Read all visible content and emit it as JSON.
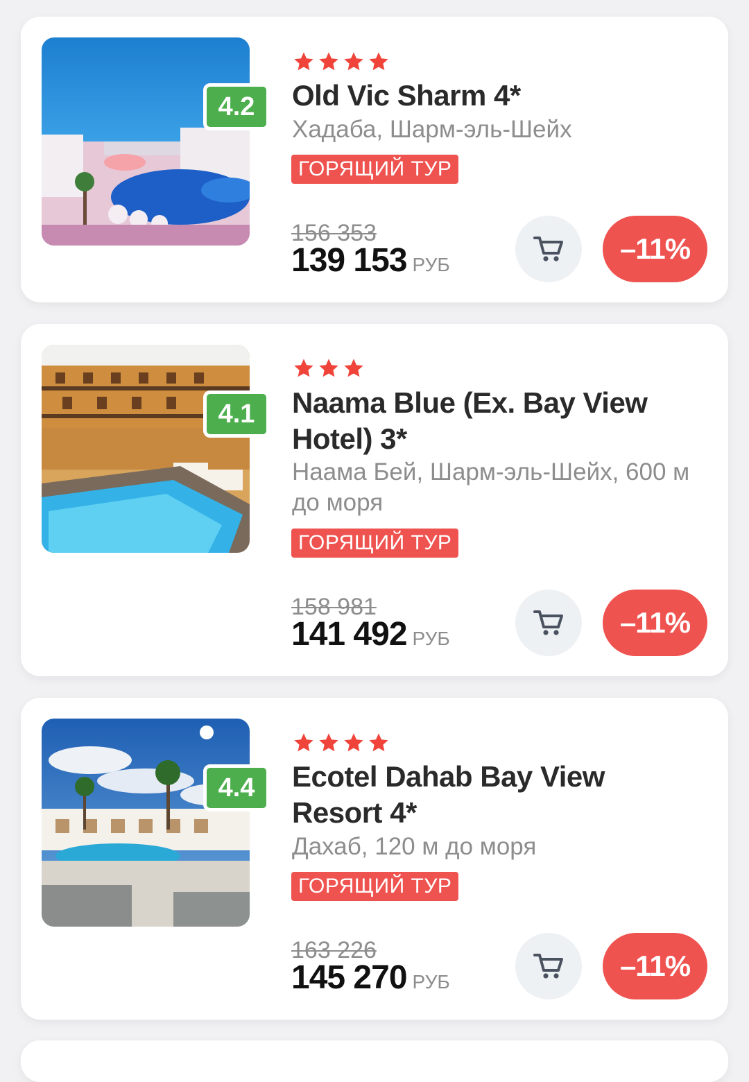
{
  "cards": [
    {
      "rating": "4.2",
      "stars": 4,
      "name": "Old Vic Sharm 4*",
      "location": "Хадаба, Шарм-эль-Шейх",
      "badge": "ГОРЯЩИЙ ТУР",
      "old_price": "156 353",
      "price": "139 153",
      "currency": "РУБ",
      "discount": "–11%"
    },
    {
      "rating": "4.1",
      "stars": 3,
      "name": "Naama Blue (Ex. Bay View Hotel) 3*",
      "location": "Наама Бей, Шарм-эль-Шейх, 600 м до моря",
      "badge": "ГОРЯЩИЙ ТУР",
      "old_price": "158 981",
      "price": "141 492",
      "currency": "РУБ",
      "discount": "–11%"
    },
    {
      "rating": "4.4",
      "stars": 4,
      "name": "Ecotel Dahab Bay View Resort 4*",
      "location": "Дахаб, 120 м до моря",
      "badge": "ГОРЯЩИЙ ТУР",
      "old_price": "163 226",
      "price": "145 270",
      "currency": "РУБ",
      "discount": "–11%"
    }
  ],
  "colors": {
    "accent_red": "#ef5350",
    "rating_green": "#4cae4c",
    "star_red": "#f0443a"
  },
  "icons": {
    "star": "star-icon",
    "cart": "cart-icon"
  }
}
